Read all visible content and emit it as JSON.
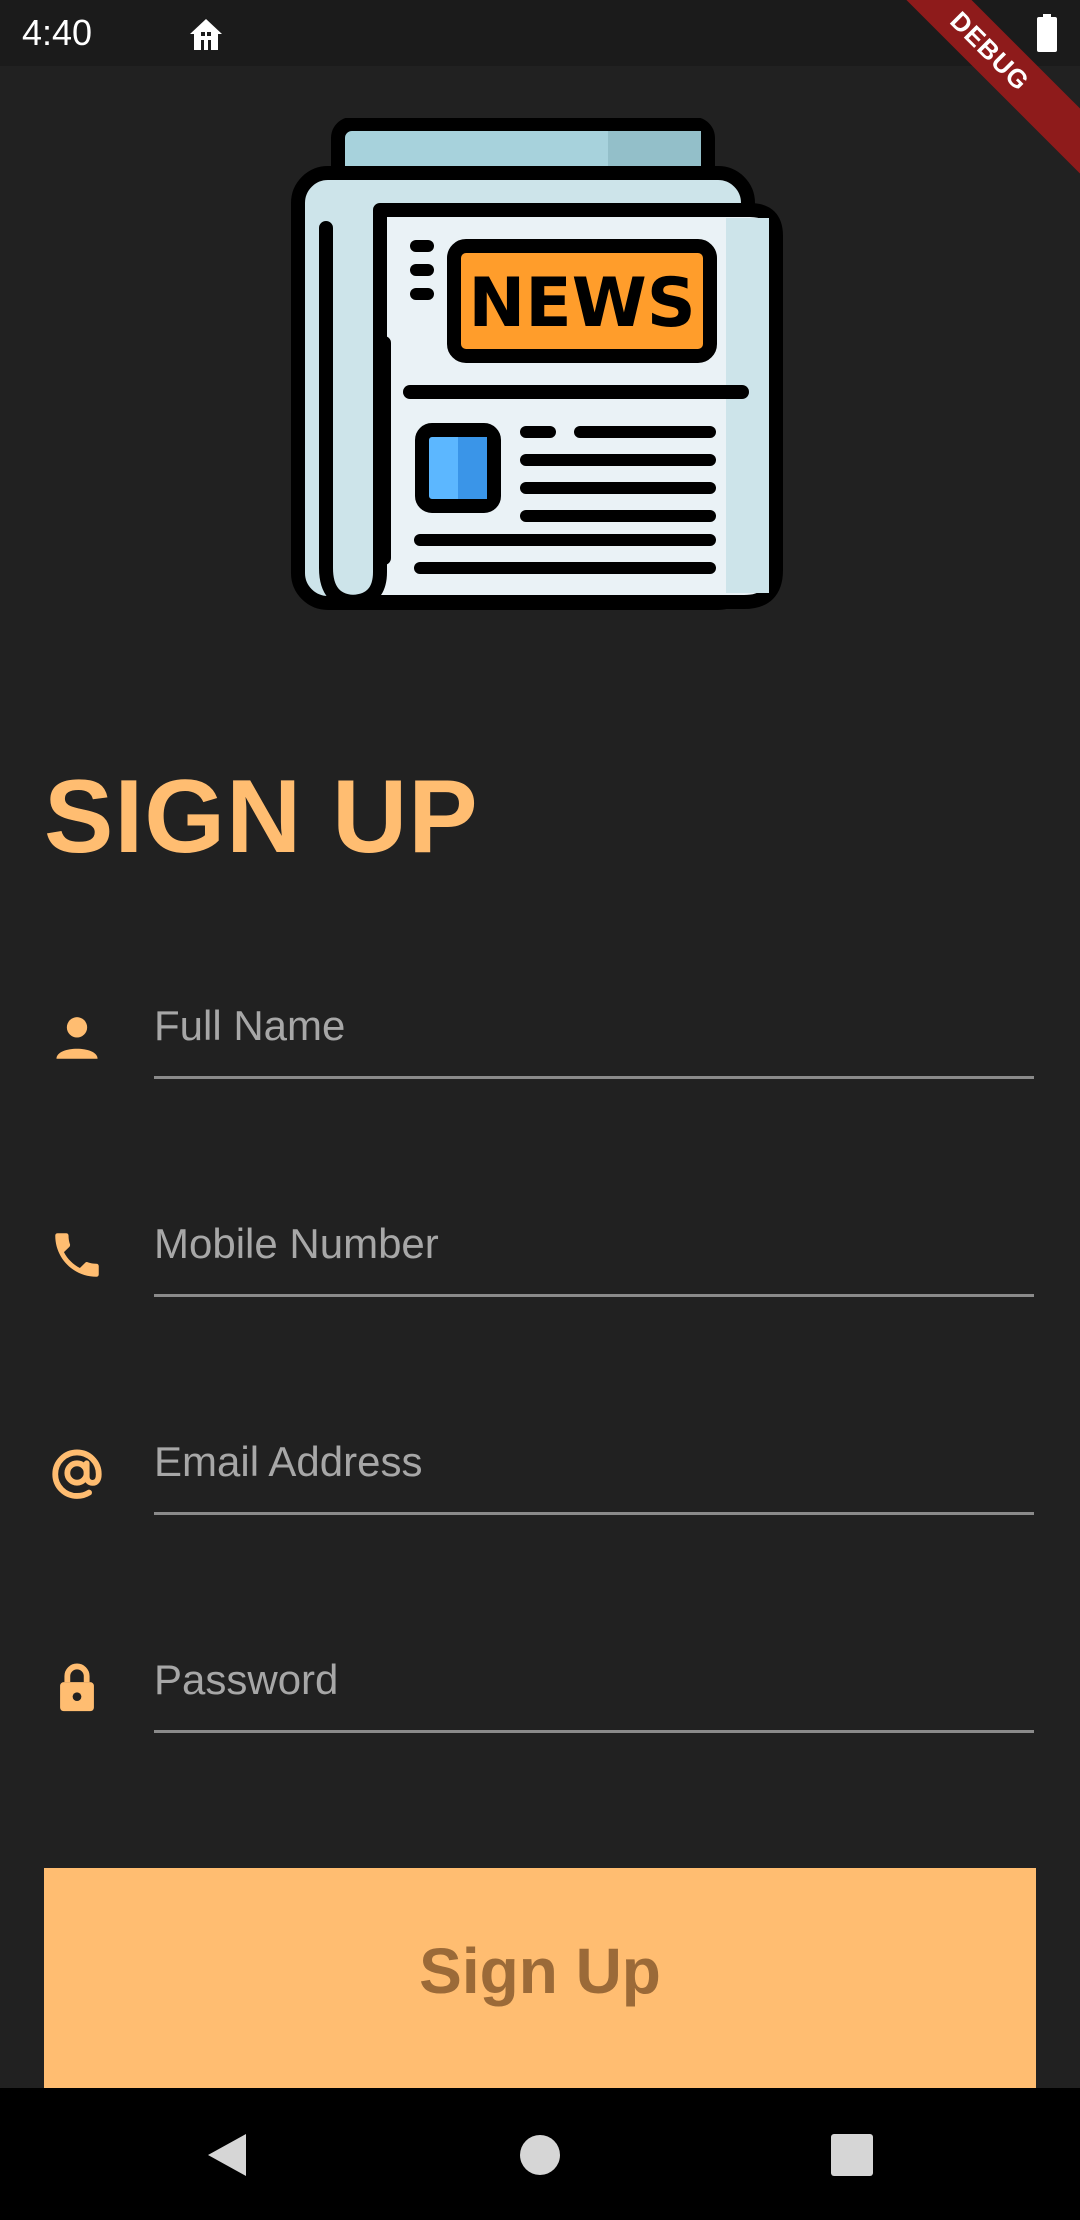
{
  "status_bar": {
    "time": "4:40",
    "icons": [
      "app-notification-icon",
      "battery-icon"
    ]
  },
  "debug_banner": "DEBUG",
  "hero": {
    "icon": "newspaper-icon",
    "label": "NEWS",
    "colors": {
      "badge": "#ff9d2b",
      "paper": "#eaf2f6",
      "tab": "#a7d2dc",
      "photo": "#5cb7ff"
    }
  },
  "page": {
    "title": "SIGN UP",
    "accent": "#ffbd71",
    "background": "#212121"
  },
  "form": {
    "fields": [
      {
        "icon": "person-icon",
        "placeholder": "Full Name",
        "value": ""
      },
      {
        "icon": "phone-icon",
        "placeholder": "Mobile Number",
        "value": ""
      },
      {
        "icon": "at-sign-icon",
        "placeholder": "Email Address",
        "value": ""
      },
      {
        "icon": "lock-icon",
        "placeholder": "Password",
        "value": ""
      }
    ],
    "submit_label": "Sign Up"
  },
  "nav": {
    "buttons": [
      "back-icon",
      "home-icon",
      "recents-icon"
    ]
  }
}
